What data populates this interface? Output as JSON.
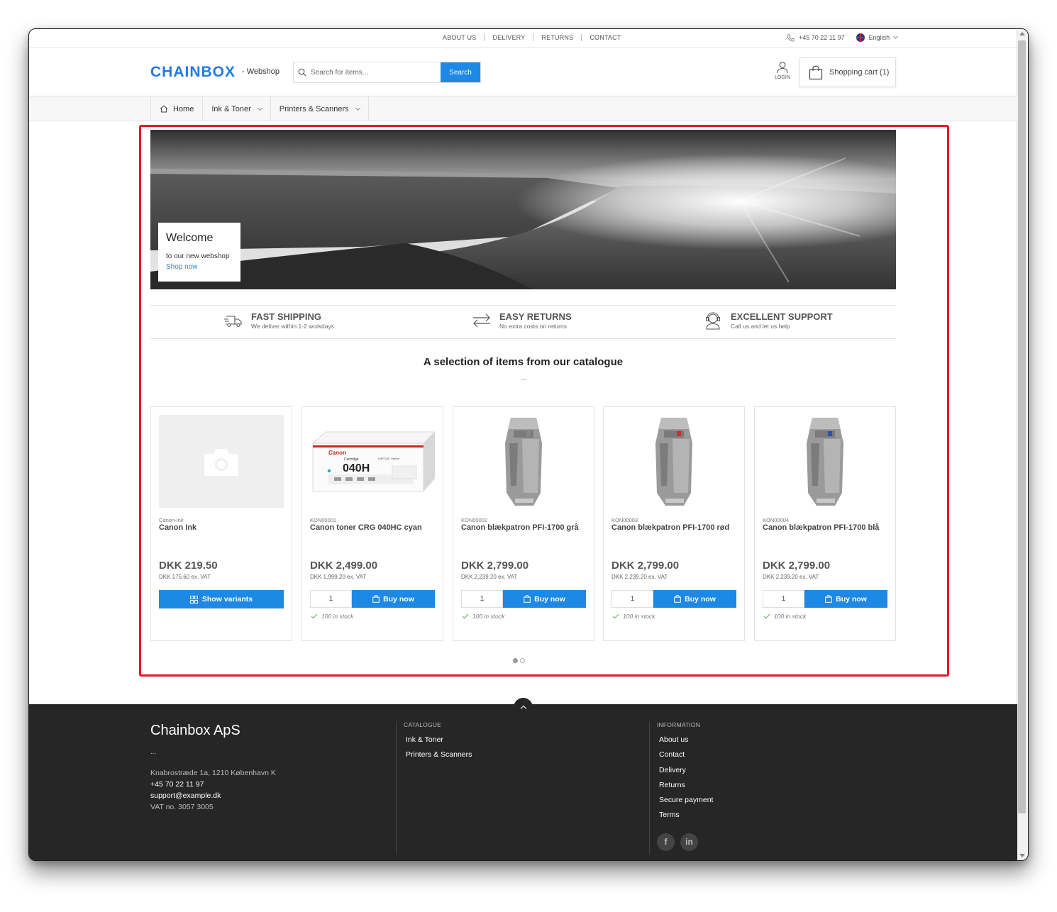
{
  "topbar": {
    "links": [
      "ABOUT US",
      "DELIVERY",
      "RETURNS",
      "CONTACT"
    ],
    "phone": "+45 70 22 11 97",
    "language": "English"
  },
  "header": {
    "logo": "CHAINBOX",
    "tagline": "- Webshop",
    "search_placeholder": "Search for items...",
    "search_button": "Search",
    "login_label": "LOGIN",
    "cart_label": "Shopping cart (1)"
  },
  "nav": {
    "home": "Home",
    "ink_toner": "Ink & Toner",
    "printers": "Printers & Scanners"
  },
  "hero": {
    "title": "Welcome",
    "subtitle": "to our new webshop",
    "link": "Shop now"
  },
  "features": [
    {
      "title": "FAST SHIPPING",
      "subtitle": "We deliver within 1-2 workdays",
      "icon": "truck-icon"
    },
    {
      "title": "EASY RETURNS",
      "subtitle": "No extra costs on returns",
      "icon": "exchange-arrows-icon"
    },
    {
      "title": "EXCELLENT SUPPORT",
      "subtitle": "Call us and let us help",
      "icon": "support-headset-icon"
    }
  ],
  "catalogue": {
    "title": "A selection of items from our catalogue",
    "subtitle": "..."
  },
  "products": [
    {
      "sku": "Canon-Ink",
      "name": "Canon Ink",
      "price": "DKK 219.50",
      "exvat": "DKK 175.60 ex. VAT",
      "action": "Show variants",
      "qty": "",
      "stock": ""
    },
    {
      "sku": "KON00001",
      "name": "Canon toner CRG 040HC cyan",
      "price": "DKK 2,499.00",
      "exvat": "DKK 1,999.20 ex. VAT",
      "action": "Buy now",
      "qty": "1",
      "stock": "100 in stock"
    },
    {
      "sku": "KON00002",
      "name": "Canon blækpatron PFI-1700 grå",
      "price": "DKK 2,799.00",
      "exvat": "DKK 2,239.20 ex. VAT",
      "action": "Buy now",
      "qty": "1",
      "stock": "100 in stock"
    },
    {
      "sku": "KON00003",
      "name": "Canon blækpatron PFI-1700 rød",
      "price": "DKK 2,799.00",
      "exvat": "DKK 2,239.20 ex. VAT",
      "action": "Buy now",
      "qty": "1",
      "stock": "100 in stock"
    },
    {
      "sku": "KON00004",
      "name": "Canon blækpatron PFI-1700 blå",
      "price": "DKK 2,799.00",
      "exvat": "DKK 2,239.20 ex. VAT",
      "action": "Buy now",
      "qty": "1",
      "stock": "100 in stock"
    }
  ],
  "toner_box": {
    "brand": "Canon",
    "model": "040H",
    "cartridge": "Cartridge",
    "series": "LBP710C Series"
  },
  "footer": {
    "company": "Chainbox ApS",
    "dots": "...",
    "address": "Knabrostræde 1a, 1210 København K",
    "phone": "+45 70 22 11 97",
    "email": "support@example.dk",
    "vat": "VAT no. 3057 3005",
    "catalogue_heading": "CATALOGUE",
    "catalogue_links": [
      "Ink & Toner",
      "Printers & Scanners"
    ],
    "info_heading": "INFORMATION",
    "info_links": [
      "About us",
      "Contact",
      "Delivery",
      "Returns",
      "Secure payment",
      "Terms"
    ],
    "social": [
      "f",
      "in"
    ]
  },
  "colors": {
    "accent": "#1e88e5",
    "logo": "#1e7be0",
    "highlight": "#e4172b",
    "footer_bg": "#262626"
  }
}
